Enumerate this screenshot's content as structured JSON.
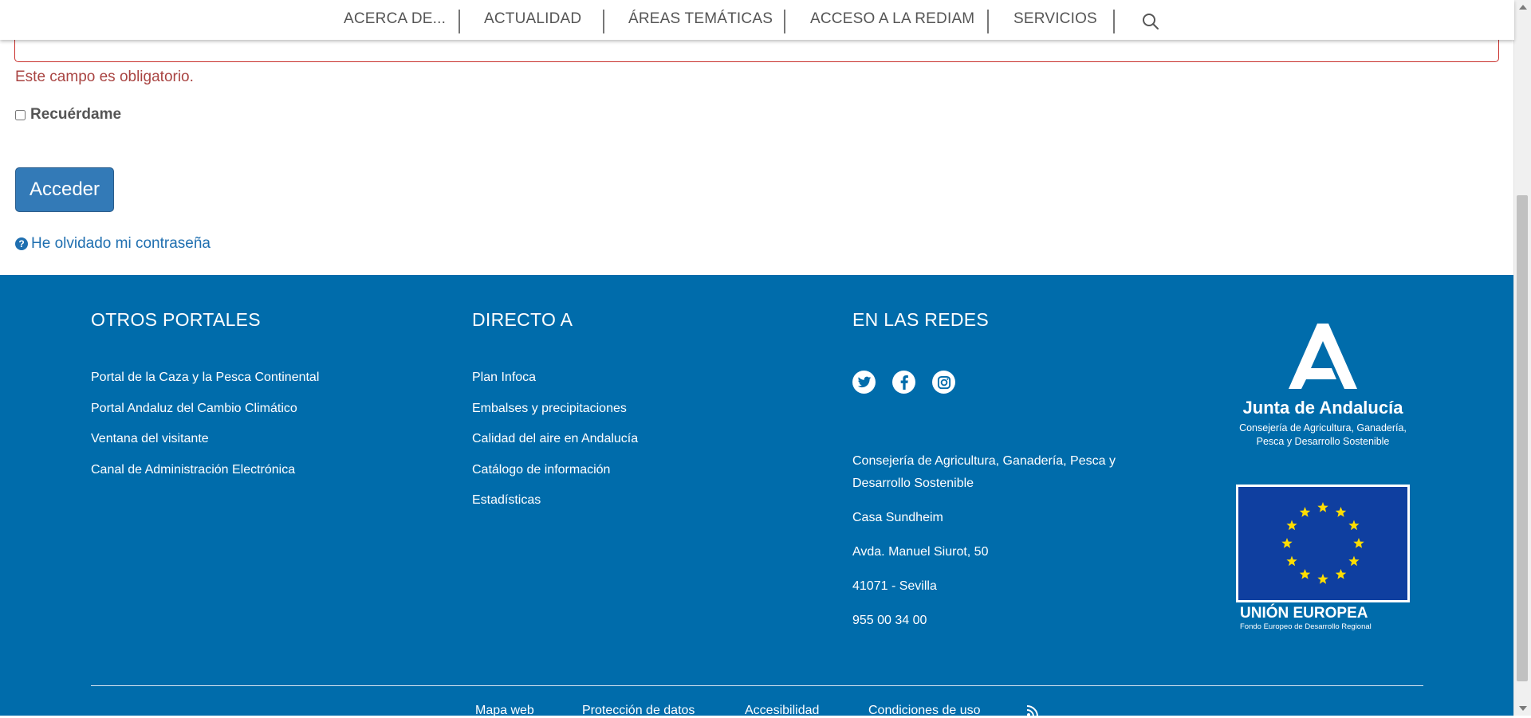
{
  "nav": {
    "items": [
      "ACERCA DE...",
      "ACTUALIDAD",
      "ÁREAS TEMÁTICAS",
      "ACCESO A LA REDIAM",
      "SERVICIOS"
    ],
    "search_icon": "search-icon"
  },
  "form": {
    "error": "Este campo es obligatorio.",
    "remember_label": "Recuérdame",
    "remember_checked": false,
    "submit_label": "Acceder",
    "forgot_label": "He olvidado mi contraseña"
  },
  "footer": {
    "otros": {
      "title": "OTROS PORTALES",
      "links": [
        "Portal de la Caza y la Pesca Continental",
        "Portal Andaluz del Cambio Climático",
        "Ventana del visitante",
        "Canal de Administración Electrónica"
      ]
    },
    "directo": {
      "title": "DIRECTO A",
      "links": [
        "Plan Infoca",
        "Embalses y precipitaciones",
        "Calidad del aire en Andalucía",
        "Catálogo de información",
        "Estadísticas"
      ]
    },
    "redes": {
      "title": "EN LAS REDES",
      "icons": [
        "twitter-icon",
        "facebook-icon",
        "instagram-icon"
      ],
      "address": [
        "Consejería de Agricultura, Ganadería, Pesca y Desarrollo Sostenible",
        "Casa Sundheim",
        "Avda. Manuel Siurot, 50",
        "41071 - Sevilla",
        "955 00 34 00"
      ]
    },
    "junta": {
      "name": "Junta de Andalucía",
      "sub1": "Consejería de Agricultura, Ganadería,",
      "sub2": "Pesca y Desarrollo Sostenible"
    },
    "eu": {
      "title": "UNIÓN EUROPEA",
      "sub": "Fondo Europeo de Desarrollo Regional"
    },
    "bottom": [
      "Mapa web",
      "Protección de datos",
      "Accesibilidad",
      "Condiciones de uso"
    ],
    "rss_icon": "rss-icon"
  },
  "colors": {
    "footer_bg": "#006cab",
    "primary": "#337ab7",
    "error": "#a94442",
    "link": "#1f6fb0"
  }
}
